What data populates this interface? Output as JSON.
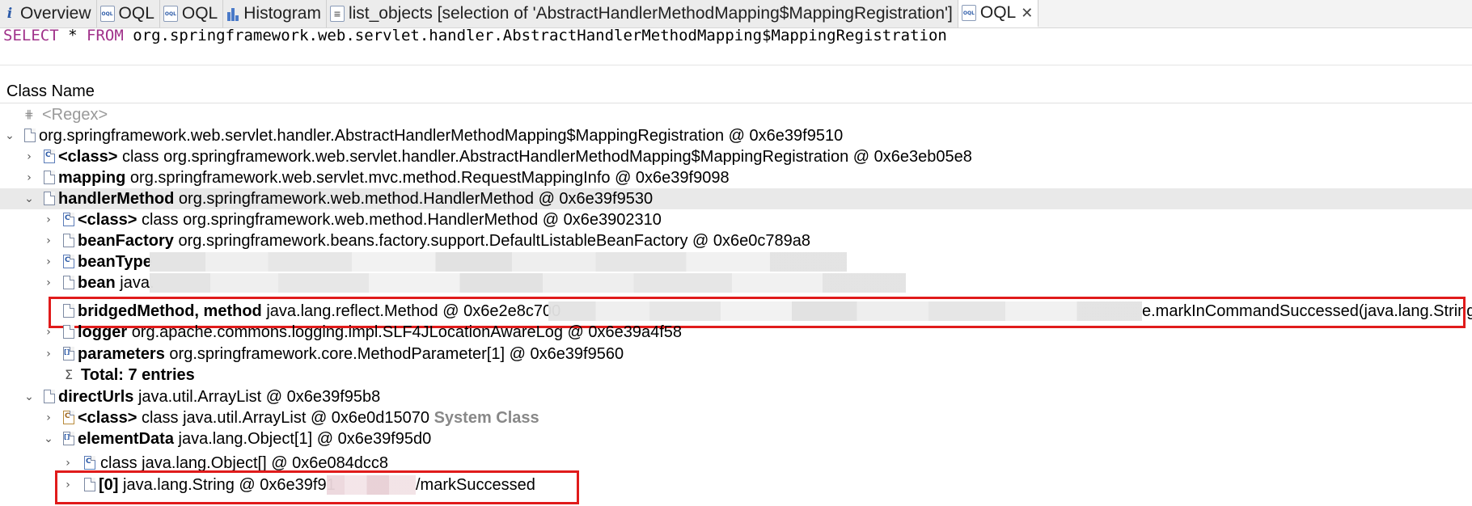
{
  "tabs": [
    {
      "icon": "info-icon",
      "label": "Overview",
      "active": false
    },
    {
      "icon": "oql-icon",
      "label": "OQL",
      "active": false
    },
    {
      "icon": "oql-icon",
      "label": "OQL",
      "active": false
    },
    {
      "icon": "histogram-icon",
      "label": "Histogram",
      "active": false
    },
    {
      "icon": "list-objects-icon",
      "label": "list_objects [selection of 'AbstractHandlerMethodMapping$MappingRegistration']",
      "active": false
    },
    {
      "icon": "oql-icon",
      "label": "OQL",
      "active": true,
      "close": "✕"
    }
  ],
  "tab_icon_text": {
    "info": "i",
    "oql": "OQL",
    "list": "≡"
  },
  "query": {
    "keyword_select": "SELECT",
    "star": "*",
    "keyword_from": "FROM",
    "class": "org.springframework.web.servlet.handler.AbstractHandlerMethodMapping$MappingRegistration"
  },
  "column_header": "Class Name",
  "tree": {
    "regex": "<Regex>",
    "root": "org.springframework.web.servlet.handler.AbstractHandlerMethodMapping$MappingRegistration @ 0x6e39f9510",
    "r_class": {
      "name": "<class>",
      "value": "class org.springframework.web.servlet.handler.AbstractHandlerMethodMapping$MappingRegistration @ 0x6e3eb05e8"
    },
    "r_mapping": {
      "name": "mapping",
      "value": "org.springframework.web.servlet.mvc.method.RequestMappingInfo @ 0x6e39f9098"
    },
    "r_handler": {
      "name": "handlerMethod",
      "value": "org.springframework.web.method.HandlerMethod @ 0x6e39f9530"
    },
    "h_class": {
      "name": "<class>",
      "value": "class org.springframework.web.method.HandlerMethod @ 0x6e3902310"
    },
    "h_beanFactory": {
      "name": "beanFactory",
      "value": "org.springframework.beans.factory.support.DefaultListableBeanFactory @ 0x6e0c789a8"
    },
    "h_beanType": {
      "name": "beanType",
      "value": ""
    },
    "h_bean": {
      "name": "bean",
      "value": "java."
    },
    "h_bridged": {
      "name": "bridgedMethod, method",
      "value": "java.lang.reflect.Method @ 0x6e2e8c700",
      "tail": "e.markInCommandSuccessed(java.lang.String)"
    },
    "h_logger": {
      "name": "logger",
      "value": "org.apache.commons.logging.impl.SLF4JLocationAwareLog @ 0x6e39a4f58"
    },
    "h_parameters": {
      "name": "parameters",
      "value": "org.springframework.core.MethodParameter[1] @ 0x6e39f9560"
    },
    "h_total": "Total: 7 entries",
    "r_directUrls": {
      "name": "directUrls",
      "value": "java.util.ArrayList @ 0x6e39f95b8"
    },
    "d_class": {
      "name": "<class>",
      "value": "class java.util.ArrayList @ 0x6e0d15070",
      "suffix": "System Class"
    },
    "d_elementData": {
      "name": "elementData",
      "value": "java.lang.Object[1] @ 0x6e39f95d0"
    },
    "e_class": {
      "value": "class java.lang.Object[] @ 0x6e084dcc8"
    },
    "e_0": {
      "name": "[0]",
      "value": "java.lang.String @ 0x6e39f91",
      "tail": "/markSuccessed"
    }
  },
  "twisty": {
    "collapsed": "›",
    "expanded": "⌄"
  },
  "sigma": "Σ",
  "regex_icon": "⋕"
}
